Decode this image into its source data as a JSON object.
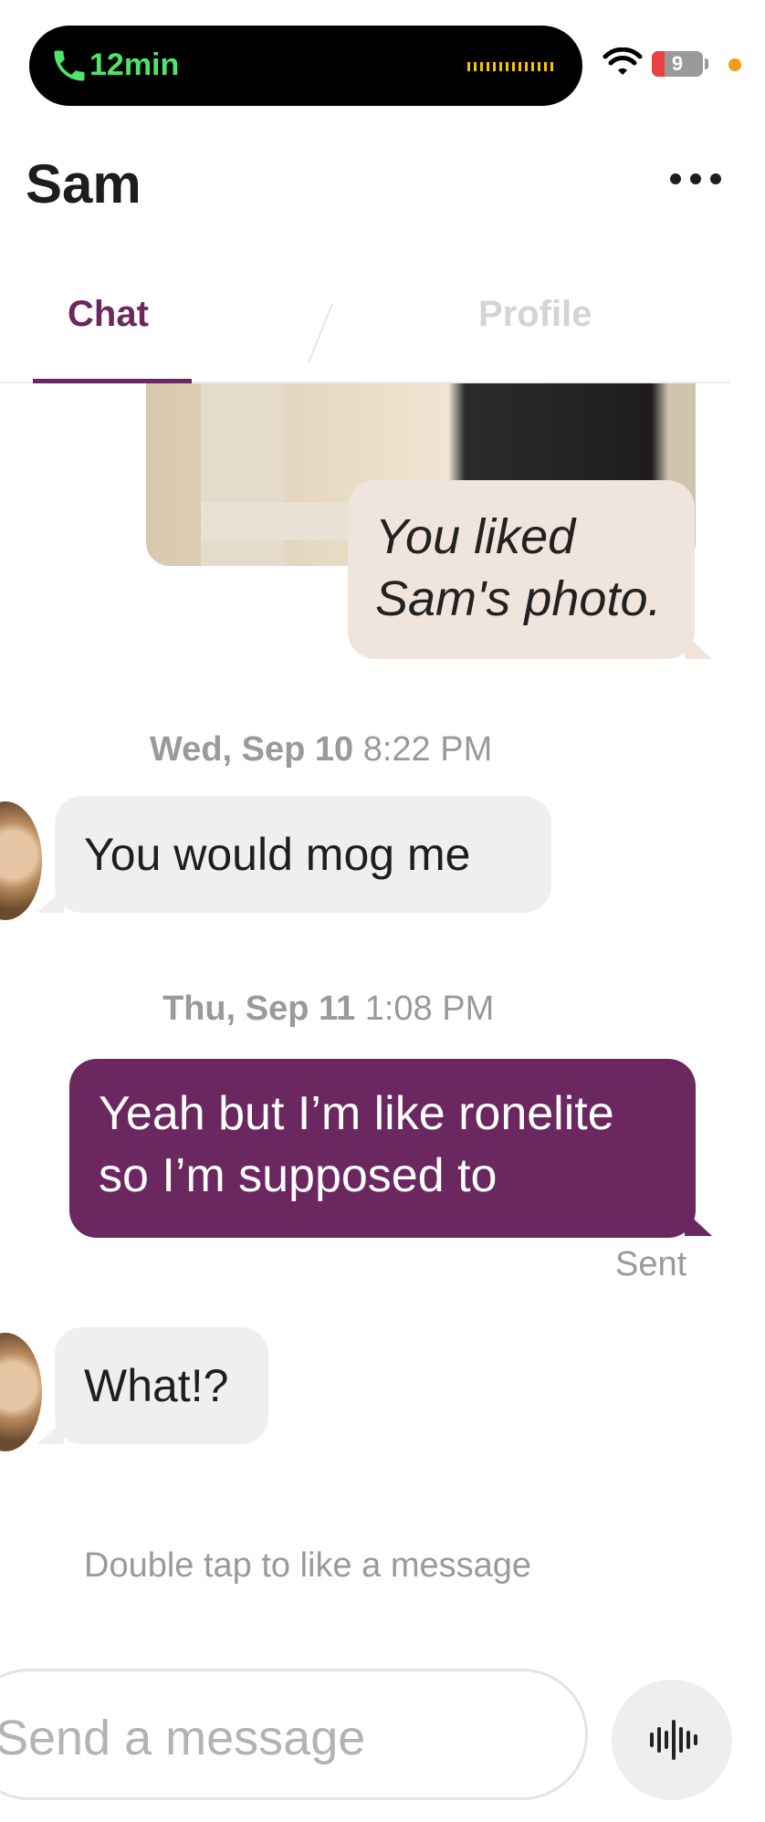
{
  "status_bar": {
    "call_timer": "12min",
    "battery_level": "9"
  },
  "header": {
    "title": "Sam"
  },
  "tabs": [
    {
      "label": "Chat",
      "active": true
    },
    {
      "label": "Profile",
      "active": false
    }
  ],
  "messages": {
    "photo_like": "You liked Sam's photo.",
    "date1": {
      "day": "Wed, Sep 10",
      "time": "8:22 PM"
    },
    "incoming1": "You would mog me",
    "date2": {
      "day": "Thu, Sep 11",
      "time": "1:08 PM"
    },
    "outgoing1": "Yeah but I’m like ronelite so I’m supposed to",
    "status": "Sent",
    "incoming2": "What!?"
  },
  "hint": "Double tap to like a message",
  "composer": {
    "placeholder": "Send a message",
    "value": ""
  },
  "colors": {
    "brand": "#6b275f",
    "incoming_bubble": "#efefef",
    "liked_bubble": "#efe5dd"
  }
}
